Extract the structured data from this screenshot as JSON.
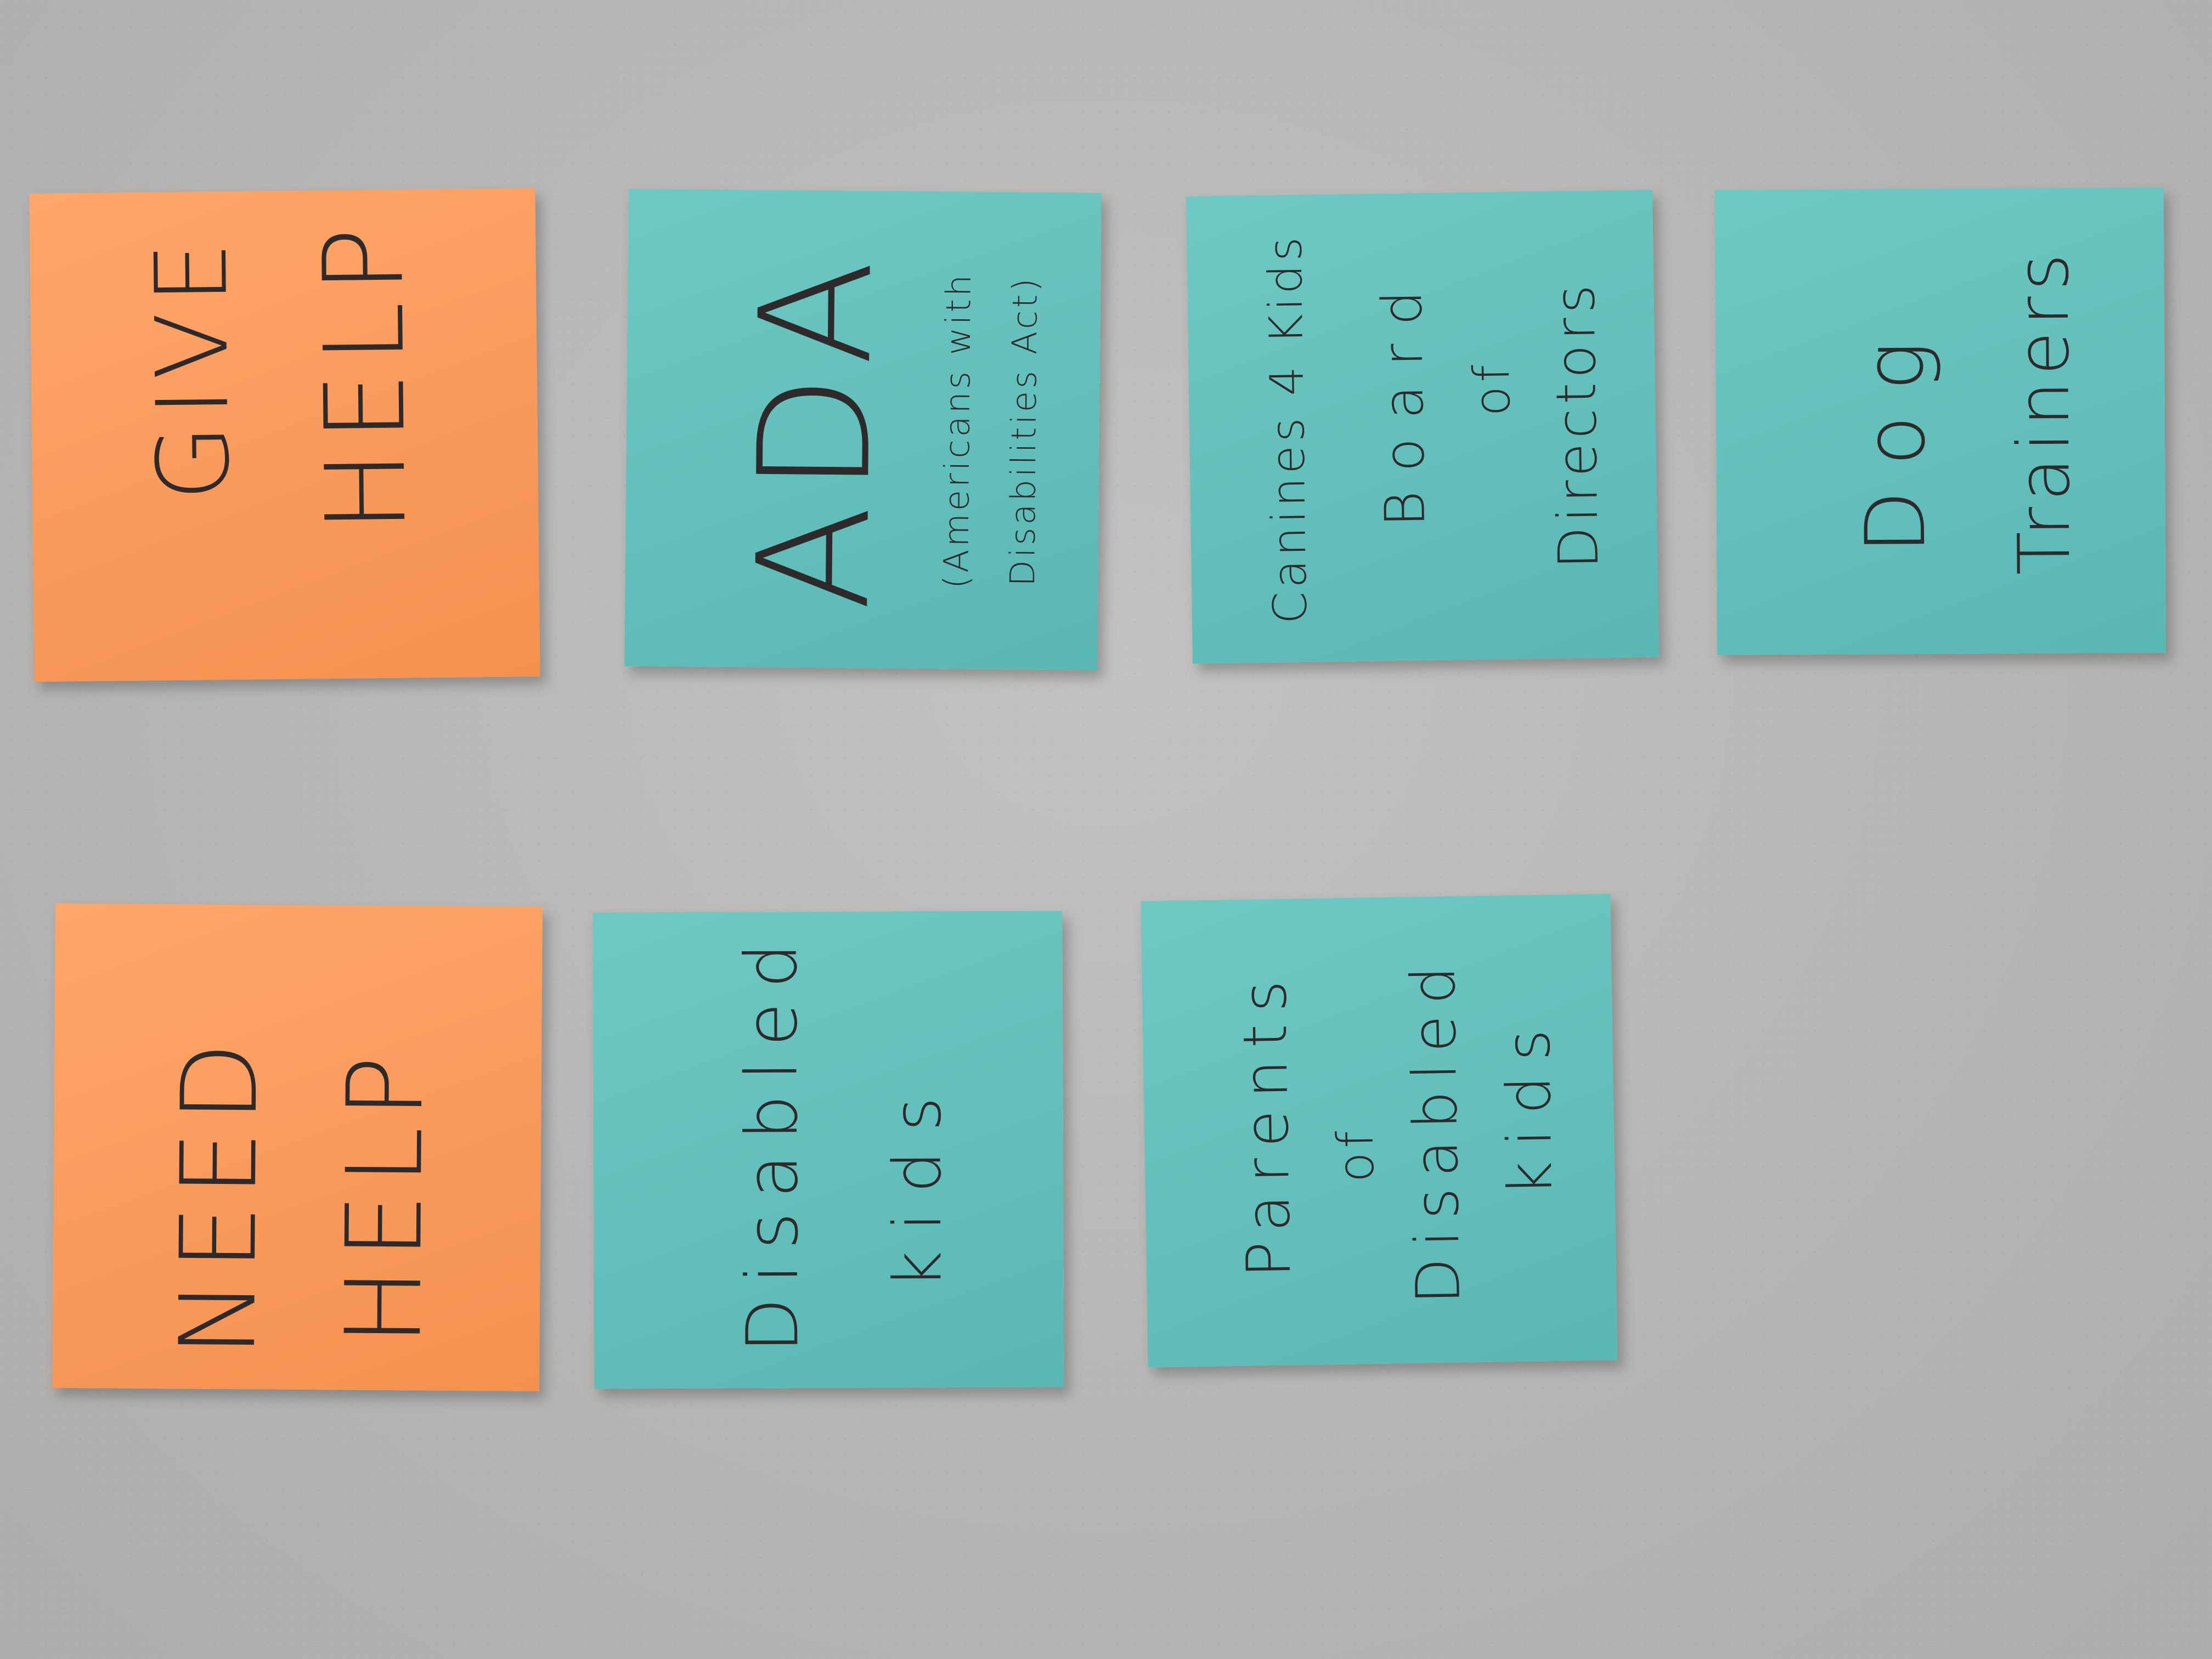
{
  "notes": {
    "give_help": {
      "line1": "GIVE",
      "line2": "HELP"
    },
    "ada": {
      "title": "ADA",
      "sub1": "(Americans with",
      "sub2": "Disabilities Act)"
    },
    "canines": {
      "line1": "Canines 4 Kids",
      "line2": "Board",
      "line3": "of",
      "line4": "Directors"
    },
    "dog": {
      "line1": "Dog",
      "line2": "Trainers"
    },
    "need_help": {
      "line1": "NEED",
      "line2": "HELP"
    },
    "disabled": {
      "line1": "Disabled",
      "line2": "kids"
    },
    "parents": {
      "line1": "Parents",
      "line2": "of",
      "line3": "Disabled",
      "line4": "kids"
    }
  },
  "colors": {
    "orange_note": "#f99a5c",
    "teal_note": "#63bfbb",
    "wall": "#b9b8b6",
    "ink": "#2e2a2c"
  }
}
